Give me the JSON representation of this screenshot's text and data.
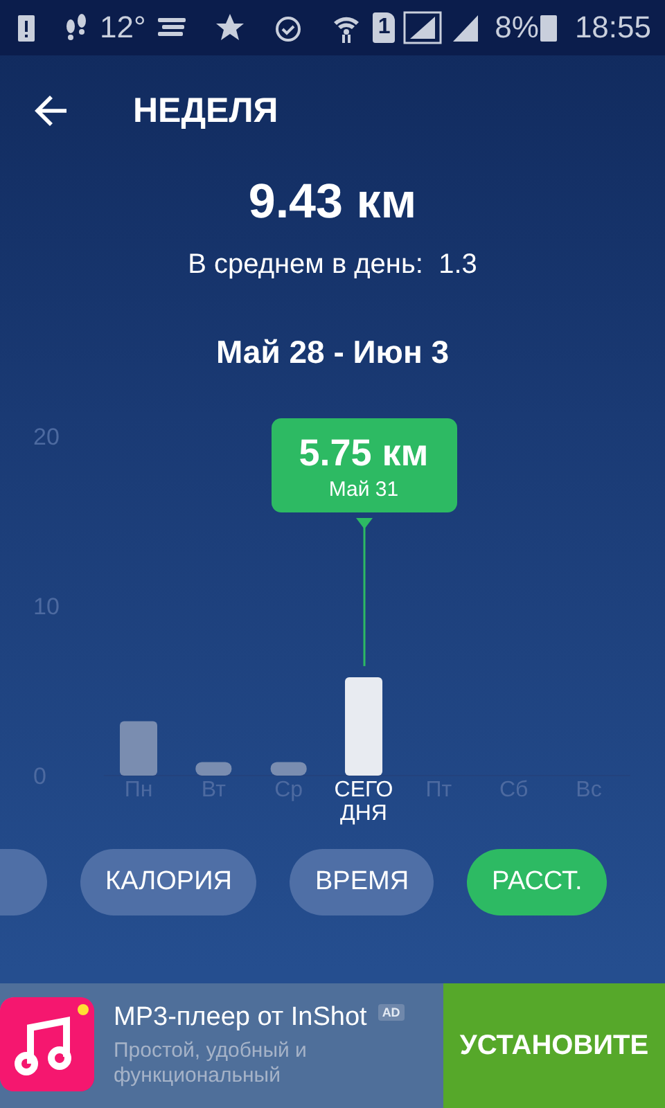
{
  "status_bar": {
    "temperature": "12°",
    "sim_slot": "1",
    "battery": "8%",
    "time": "18:55"
  },
  "header": {
    "title": "НЕДЕЛЯ"
  },
  "summary": {
    "total": "9.43 км",
    "average_label": "В среднем в день:",
    "average_value": "1.3",
    "range": "Май 28 - Июн 3"
  },
  "chart": {
    "day_selected": [
      false,
      false,
      false,
      true,
      false,
      false,
      false
    ],
    "tooltip": {
      "value": "5.75 км",
      "date": "Май 31"
    },
    "chart_data": {
      "type": "bar",
      "categories": [
        "Пн",
        "Вт",
        "Ср",
        "СЕГОДНЯ",
        "Пт",
        "Сб",
        "Вс"
      ],
      "values": [
        3.2,
        0.8,
        0.8,
        5.8,
        null,
        null,
        null
      ],
      "ylim": [
        0,
        20
      ],
      "yticks": [
        0,
        10,
        20
      ]
    }
  },
  "filters": [
    {
      "selected": false
    },
    {
      "label": "КАЛОРИЯ",
      "selected": false
    },
    {
      "label": "ВРЕМЯ",
      "selected": false
    },
    {
      "label": "РАССТ.",
      "selected": true
    }
  ],
  "ad": {
    "title": "MP3-плеер от InShot",
    "badge": "AD",
    "description": "Простой, удобный и функциональный",
    "button": "УСТАНОВИТЕ"
  }
}
